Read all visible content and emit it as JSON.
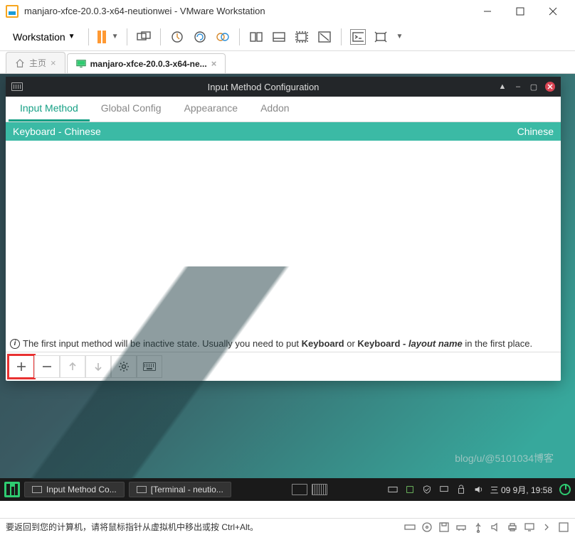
{
  "window": {
    "title": "manjaro-xfce-20.0.3-x64-neutionwei - VMware Workstation"
  },
  "vmware": {
    "menu": "Workstation",
    "tabs": {
      "home": "主页",
      "active": "manjaro-xfce-20.0.3-x64-ne..."
    },
    "status_msg": "要返回到您的计算机，请将鼠标指针从虚拟机中移出或按 Ctrl+Alt。"
  },
  "config": {
    "title": "Input Method Configuration",
    "tabs": [
      "Input Method",
      "Global Config",
      "Appearance",
      "Addon"
    ],
    "active_tab": 0,
    "list": [
      {
        "name": "Keyboard - Chinese",
        "lang": "Chinese"
      }
    ],
    "info_pre": "The first input method will be inactive state. Usually you need to put ",
    "info_b1": "Keyboard",
    "info_or": " or ",
    "info_b2": "Keyboard - ",
    "info_i": "layout name",
    "info_post": " in the first place."
  },
  "panel": {
    "task1": "Input Method Co...",
    "task2": "[Terminal - neutio...",
    "clock": "三 09 9月, 19:58"
  },
  "watermark": "blog/u/@5101034博客"
}
